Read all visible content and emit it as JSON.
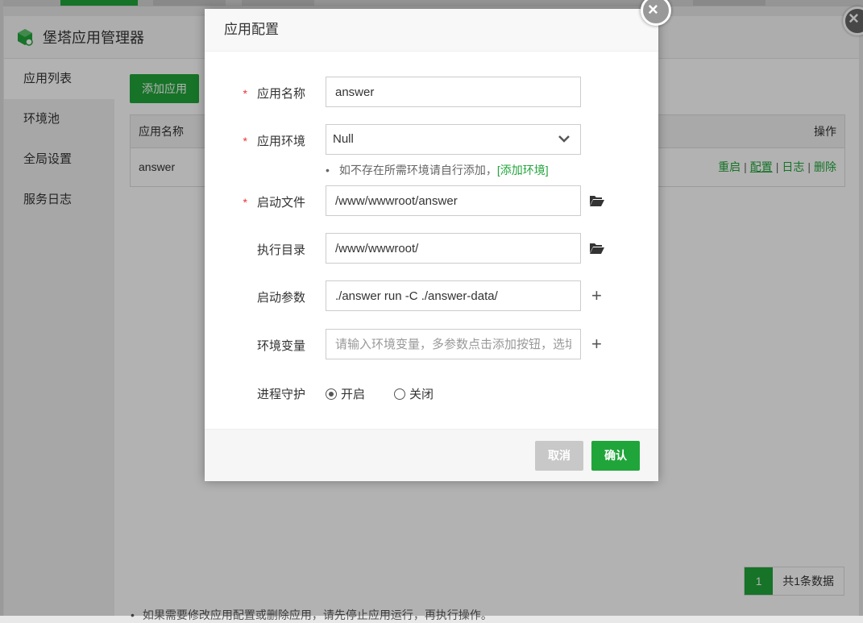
{
  "manager": {
    "title": "堡塔应用管理器",
    "sidebar": [
      "应用列表",
      "环境池",
      "全局设置",
      "服务日志"
    ],
    "add_button": "添加应用",
    "table": {
      "headers": [
        "应用名称",
        "操作"
      ],
      "rows": [
        {
          "name": "answer",
          "ops": [
            "重启",
            "配置",
            "日志",
            "删除"
          ]
        }
      ]
    },
    "pager": {
      "page": "1",
      "total": "共1条数据"
    },
    "tip": "如果需要修改应用配置或删除应用，请先停止应用运行，再执行操作。"
  },
  "dialog": {
    "title": "应用配置",
    "fields": {
      "app_name": {
        "label": "应用名称",
        "value": "answer"
      },
      "env": {
        "label": "应用环境",
        "value": "Null"
      },
      "env_hint": "如不存在所需环境请自行添加，",
      "env_link": "[添加环境]",
      "start_file": {
        "label": "启动文件",
        "value": "/www/wwwroot/answer"
      },
      "exec_dir": {
        "label": "执行目录",
        "value": "/www/wwwroot/"
      },
      "start_args": {
        "label": "启动参数",
        "value": "./answer run -C ./answer-data/"
      },
      "env_vars": {
        "label": "环境变量",
        "placeholder": "请输入环境变量，多参数点击添加按钮，选填"
      },
      "guard": {
        "label": "进程守护",
        "on": "开启",
        "off": "关闭",
        "selected": "开启"
      }
    },
    "required_mark": "*",
    "buttons": {
      "cancel": "取消",
      "confirm": "确认"
    }
  },
  "colors": {
    "accent": "#20a53a",
    "required": "#ee3333"
  },
  "icons": [
    "close-icon",
    "folder-open-icon",
    "plus-icon",
    "chevron-down-icon",
    "app-logo-icon"
  ]
}
